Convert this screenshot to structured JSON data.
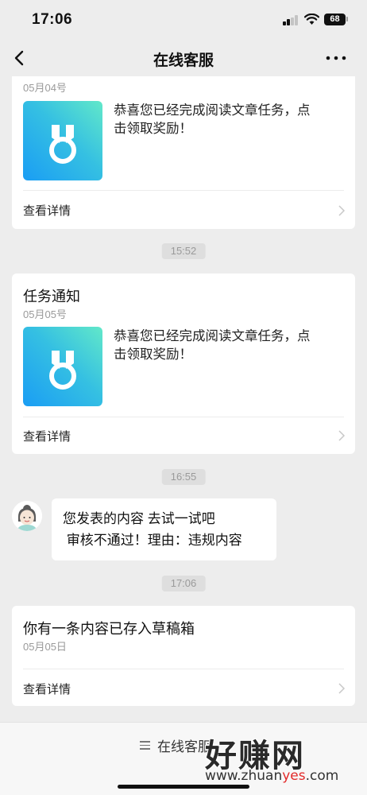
{
  "status_bar": {
    "time": "17:06",
    "battery": "68"
  },
  "nav": {
    "title": "在线客服",
    "back_icon": "chevron-left-icon",
    "more_icon": "more-dots-icon"
  },
  "card1": {
    "date": "05月04号",
    "body_line1": "恭喜您已经完成阅读文章任务，点",
    "body_line2": "击领取奖励！",
    "link": "查看详情",
    "thumb_icon": "medal-icon"
  },
  "timestamps": {
    "t1": "15:52",
    "t2": "16:55",
    "t3": "17:06"
  },
  "card2": {
    "title": "任务通知",
    "date": "05月05号",
    "body_line1": "恭喜您已经完成阅读文章任务，点",
    "body_line2": "击领取奖励！",
    "link": "查看详情",
    "thumb_icon": "medal-icon"
  },
  "message": {
    "line1": "您发表的内容 去试一试吧",
    "line2": " 审核不通过！理由：违规内容",
    "avatar_icon": "agent-avatar-icon"
  },
  "card3": {
    "title": "你有一条内容已存入草稿箱",
    "date": "05月05日",
    "link": "查看详情"
  },
  "bottom_menu": {
    "label": "在线客服",
    "icon": "menu-lines-icon"
  },
  "watermark": {
    "main": "好赚网",
    "sub_prefix": "www.zhuan",
    "sub_highlight": "yes",
    "sub_suffix": ".com"
  },
  "colors": {
    "background": "#ededed",
    "card": "#ffffff",
    "thumb_gradient_start": "#1a9df4",
    "thumb_gradient_end": "#62e8c9",
    "muted_text": "#9a9a9a",
    "watermark_accent": "#e32a2a"
  }
}
